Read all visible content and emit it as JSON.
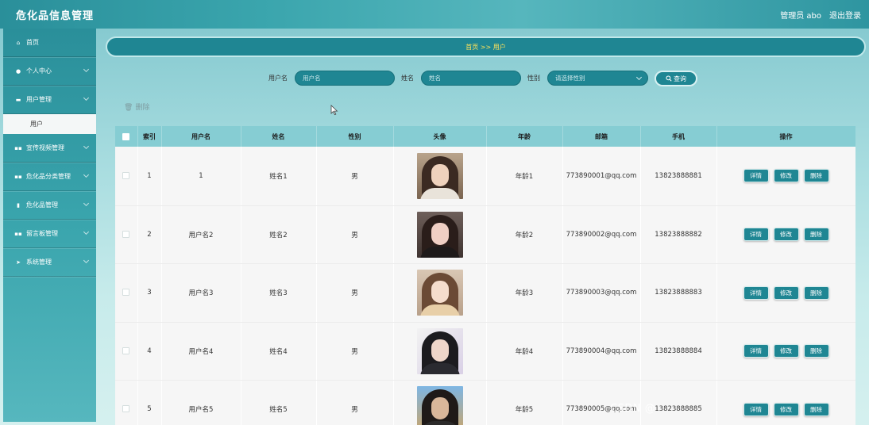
{
  "app": {
    "title": "危化品信息管理"
  },
  "header": {
    "admin_label": "管理员 abo",
    "logout_label": "退出登录"
  },
  "sidebar": {
    "items": [
      {
        "label": "首页",
        "icon": "home-icon"
      },
      {
        "label": "个人中心",
        "icon": "user-icon"
      },
      {
        "label": "用户管理",
        "icon": "monitor-icon",
        "expanded": true,
        "sub": [
          {
            "label": "用户"
          }
        ]
      },
      {
        "label": "宣传视频管理",
        "icon": "grid-icon"
      },
      {
        "label": "危化品分类管理",
        "icon": "grid-icon"
      },
      {
        "label": "危化品管理",
        "icon": "trash-icon"
      },
      {
        "label": "留言板管理",
        "icon": "grid-icon"
      },
      {
        "label": "系统管理",
        "icon": "send-icon"
      }
    ]
  },
  "breadcrumb": {
    "text": "首页 >> 用户"
  },
  "search": {
    "username_label": "用户名",
    "username_placeholder": "用户名",
    "name_label": "姓名",
    "name_placeholder": "姓名",
    "gender_label": "性别",
    "gender_placeholder": "请选择性别",
    "search_label": "查询"
  },
  "toolbar": {
    "delete_label": "删除"
  },
  "table": {
    "headers": [
      "",
      "索引",
      "用户名",
      "姓名",
      "性别",
      "头像",
      "年龄",
      "邮箱",
      "手机",
      "操作"
    ],
    "actions": {
      "detail": "详情",
      "edit": "修改",
      "delete": "删除"
    },
    "rows": [
      {
        "index": "1",
        "username": "1",
        "name": "姓名1",
        "gender": "男",
        "age": "年龄1",
        "email": "773890001@qq.com",
        "phone": "13823888881"
      },
      {
        "index": "2",
        "username": "用户名2",
        "name": "姓名2",
        "gender": "男",
        "age": "年龄2",
        "email": "773890002@qq.com",
        "phone": "13823888882"
      },
      {
        "index": "3",
        "username": "用户名3",
        "name": "姓名3",
        "gender": "男",
        "age": "年龄3",
        "email": "773890003@qq.com",
        "phone": "13823888883"
      },
      {
        "index": "4",
        "username": "用户名4",
        "name": "姓名4",
        "gender": "男",
        "age": "年龄4",
        "email": "773890004@qq.com",
        "phone": "13823888884"
      },
      {
        "index": "5",
        "username": "用户名5",
        "name": "姓名5",
        "gender": "男",
        "age": "年龄5",
        "email": "773890005@qq.com",
        "phone": "13823888885"
      }
    ]
  },
  "watermark": "CSDN @"
}
